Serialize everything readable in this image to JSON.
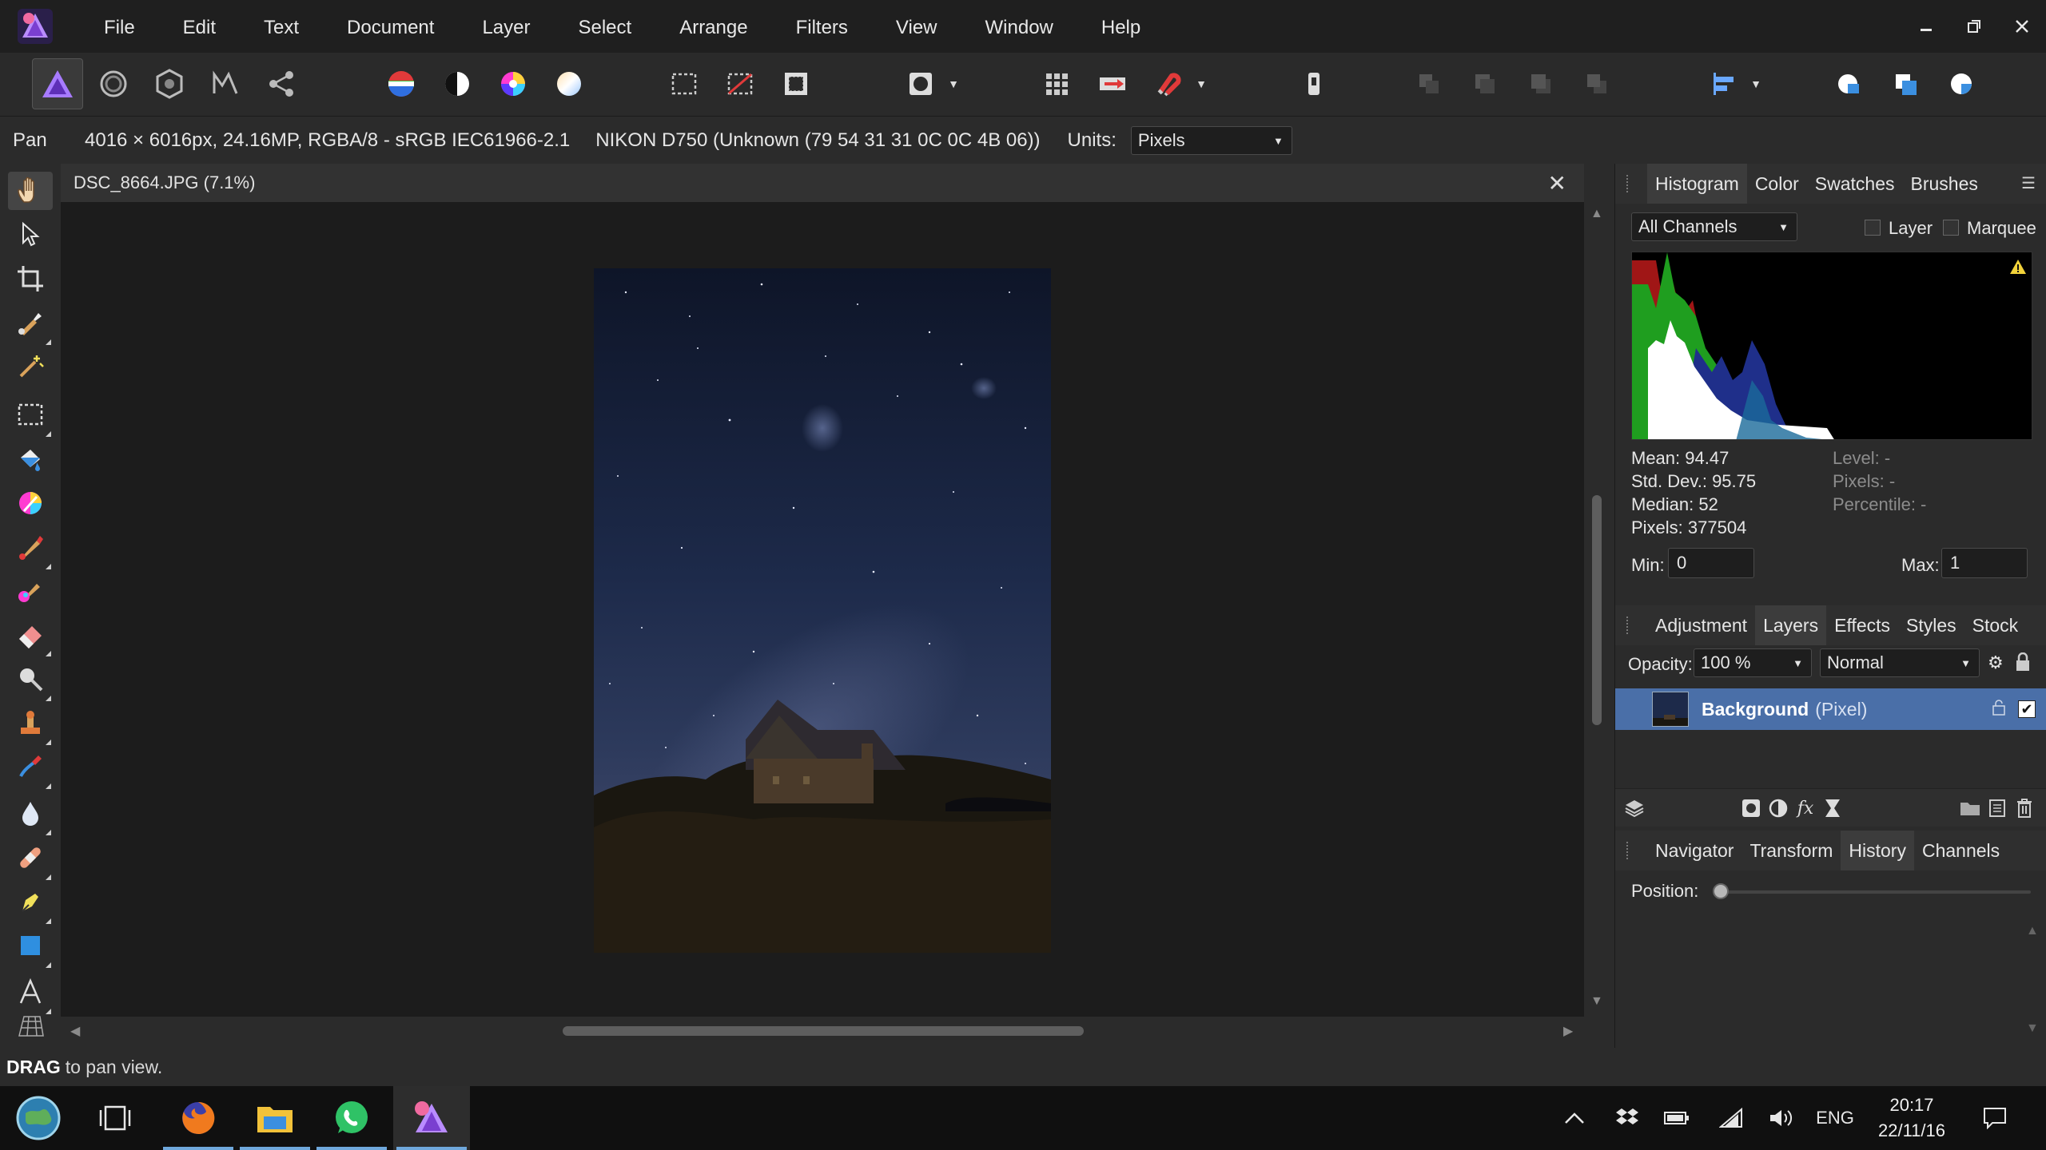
{
  "app": {
    "menu": [
      "File",
      "Edit",
      "Text",
      "Document",
      "Layer",
      "Select",
      "Arrange",
      "Filters",
      "View",
      "Window",
      "Help"
    ]
  },
  "context_bar": {
    "tool": "Pan",
    "doc_info": "4016 × 6016px, 24.16MP, RGBA/8 - sRGB IEC61966-2.1",
    "camera": "NIKON D750 (Unknown (79 54 31 31 0C 0C 4B 06))",
    "units_label": "Units:",
    "units_value": "Pixels"
  },
  "document": {
    "tab_title": "DSC_8664.JPG (7.1%)"
  },
  "panels": {
    "top_tabs": [
      "Histogram",
      "Color",
      "Swatches",
      "Brushes"
    ],
    "histogram": {
      "channel": "All Channels",
      "layer_label": "Layer",
      "marquee_label": "Marquee",
      "mean": "Mean: 94.47",
      "stddev": "Std. Dev.: 95.75",
      "median": "Median: 52",
      "pixels": "Pixels: 377504",
      "level": "Level: -",
      "pixels_r": "Pixels: -",
      "percentile": "Percentile: -",
      "min_label": "Min:",
      "min_value": "0",
      "max_label": "Max:",
      "max_value": "1"
    },
    "mid_tabs": [
      "Adjustment",
      "Layers",
      "Effects",
      "Styles",
      "Stock"
    ],
    "layers": {
      "opacity_label": "Opacity:",
      "opacity_value": "100 %",
      "blend_mode": "Normal",
      "layer_name": "Background",
      "layer_type": "(Pixel)"
    },
    "bottom_tabs": [
      "Navigator",
      "Transform",
      "History",
      "Channels"
    ],
    "history": {
      "position_label": "Position:",
      "position": 0
    }
  },
  "status": {
    "bold": "DRAG",
    "text": "to pan view."
  },
  "taskbar": {
    "language": "ENG",
    "time": "20:17",
    "date": "22/11/16"
  },
  "colors": {
    "selection": "#4a6fa8",
    "accent": "#7b4fd1"
  }
}
